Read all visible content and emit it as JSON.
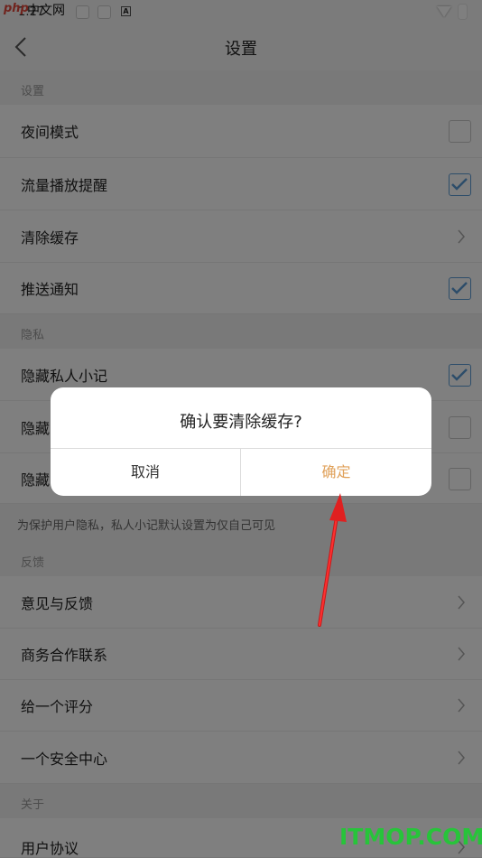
{
  "status": {
    "watermark_php": "php",
    "watermark_cn": "中文网",
    "time": "1:27"
  },
  "header": {
    "title": "设置"
  },
  "sections": {
    "settings": "设置",
    "privacy": "隐私",
    "feedback": "反馈",
    "about": "关于"
  },
  "rows": {
    "night_mode": {
      "label": "夜间模式",
      "checked": false
    },
    "data_alert": {
      "label": "流量播放提醒",
      "checked": true
    },
    "clear_cache": {
      "label": "清除缓存"
    },
    "push": {
      "label": "推送通知",
      "checked": true
    },
    "hide_notes": {
      "label": "隐藏私人小记",
      "checked": true
    },
    "hide_2": {
      "label": "隐藏",
      "checked": false
    },
    "hide_3": {
      "label": "隐藏",
      "checked": false
    },
    "feedback": {
      "label": "意见与反馈"
    },
    "business": {
      "label": "商务合作联系"
    },
    "rate": {
      "label": "给一个评分"
    },
    "security": {
      "label": "一个安全中心"
    },
    "agreement": {
      "label": "用户协议"
    }
  },
  "privacy_note": "为保护用户隐私，私人小记默认设置为仅自己可见",
  "dialog": {
    "message": "确认要清除缓存?",
    "cancel": "取消",
    "confirm": "确定"
  },
  "watermark_bottom": "ITMOP.COM",
  "colors": {
    "accent_check": "#5b9bd5",
    "confirm_text": "#e0a15a",
    "arrow": "#e02020"
  }
}
